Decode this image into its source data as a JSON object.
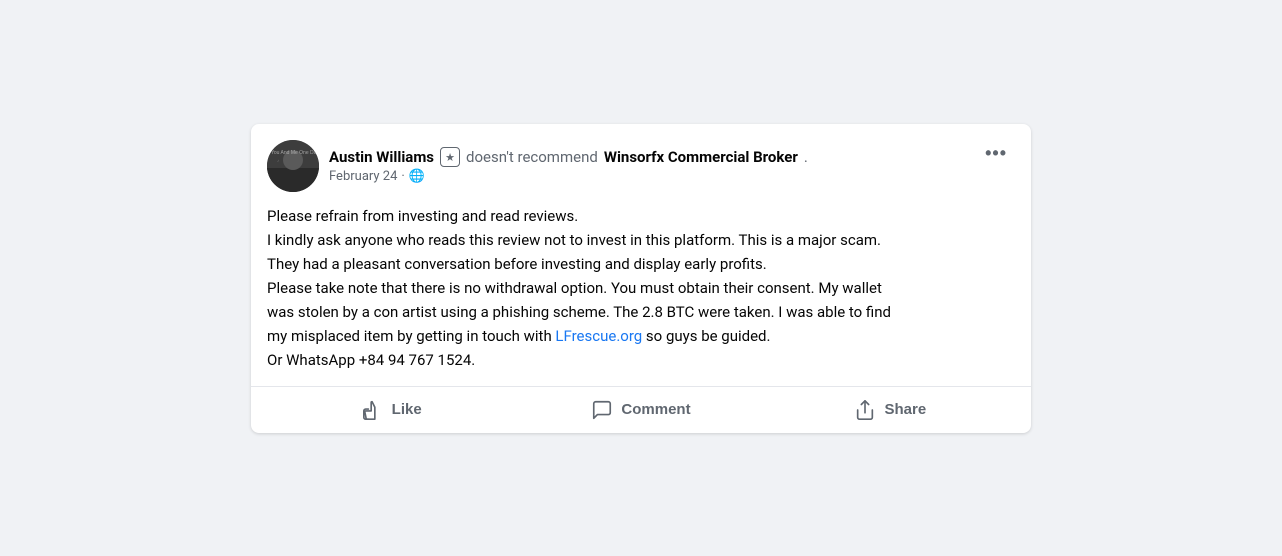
{
  "card": {
    "user": {
      "name": "Austin Williams",
      "badge": "★",
      "date": "February 24",
      "visibility": "🌐"
    },
    "recommendation": {
      "prefix": "doesn't recommend",
      "broker": "Winsorfx Commercial Broker",
      "suffix": "."
    },
    "post": {
      "line1": "Please refrain from investing  and read reviews.",
      "line2": "I kindly ask anyone who reads this review not to invest in this platform. This is a major scam.",
      "line3": "They had a pleasant conversation before investing and display early profits.",
      "line4_part1": "Please take note that there is no withdrawal option. You must obtain their consent. My wallet",
      "line4_part2": "was stolen by a con artist using a phishing scheme. The 2.8 BTC were taken. I was able to find",
      "line4_part3_before": "my misplaced item by getting in touch with ",
      "link_text": "LFrescue.org",
      "line4_part3_after": "  so guys be guided.",
      "line5": "Or WhatsApp  +84 94 767 1524."
    },
    "actions": {
      "like_label": "Like",
      "comment_label": "Comment",
      "share_label": "Share"
    },
    "more_button_label": "•••"
  }
}
